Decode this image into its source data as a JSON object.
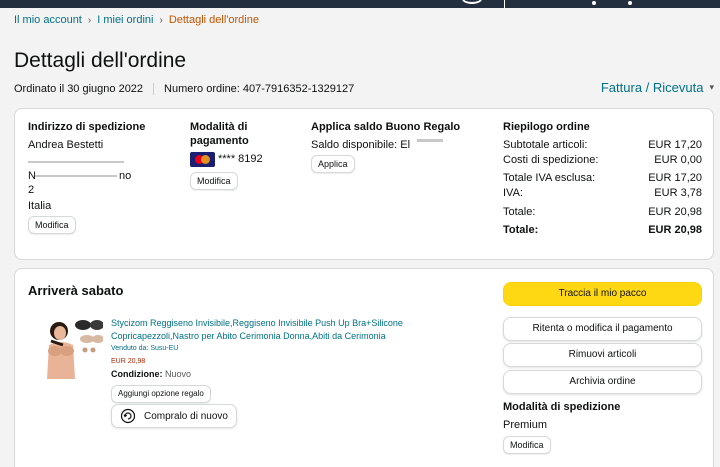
{
  "breadcrumb": [
    "Il mio account",
    "I miei ordini",
    "Dettagli dell'ordine"
  ],
  "page_title": "Dettagli dell'ordine",
  "order_date": "Ordinato il 30 giugno 2022",
  "order_number": "Numero ordine: 407-7916352-1329127",
  "invoice_link": "Fattura / Ricevuta",
  "shipping_address": {
    "heading": "Indirizzo di spedizione",
    "name": "Andrea Bestetti",
    "line1_start": "N",
    "line1_end": "no",
    "line2": "2",
    "country": "Italia",
    "edit_label": "Modifica"
  },
  "payment": {
    "heading_line1": "Modalità di",
    "heading_line2": "pagamento",
    "card_masked": "**** 8192",
    "edit_label": "Modifica",
    "card_icon": "mastercard-icon"
  },
  "gift_card": {
    "heading": "Applica saldo Buono Regalo",
    "balance": "Saldo disponibile: El",
    "apply_label": "Applica"
  },
  "summary": {
    "heading": "Riepilogo ordine",
    "rows": [
      {
        "label": "Subtotale articoli:",
        "value": "EUR 17,20"
      },
      {
        "label": "Costi di spedizione:",
        "value": "EUR 0,00"
      },
      {
        "label": "Totale IVA esclusa:",
        "value": "EUR 17,20"
      },
      {
        "label": "IVA:",
        "value": "EUR 3,78"
      },
      {
        "label": "Totale:",
        "value": "EUR 20,98"
      },
      {
        "label": "Totale:",
        "value": "EUR 20,98"
      }
    ]
  },
  "delivery": {
    "heading": "Arriverà sabato",
    "product_title_line1": "Stycizom Reggiseno Invisibile,Reggiseno Invisibile Push Up Bra+Silicone",
    "product_title_line2": "Copricapezzoli,Nastro per Abito Cerimonia Donna,Abiti da Cerimonia",
    "seller": "Venduto da: Susu-EU",
    "price": "EUR 20,98",
    "condition_label": "Condizione:",
    "condition_value": "Nuovo",
    "gift_option_label": "Aggiungi opzione regalo",
    "buy_again_label": "Compralo di nuovo",
    "track_label": "Traccia il mio pacco",
    "retry_payment_label": "Ritenta o modifica il pagamento",
    "remove_items_label": "Rimuovi articoli",
    "archive_label": "Archivia ordine",
    "shipping_mode_heading": "Modalità di spedizione",
    "shipping_mode": "Premium",
    "shipping_edit_label": "Modifica"
  },
  "colors": {
    "link": "#007185",
    "breadcrumb_current": "#c45500",
    "primary_button": "#ffd814",
    "price": "#b12704",
    "header": "#232f3e"
  }
}
